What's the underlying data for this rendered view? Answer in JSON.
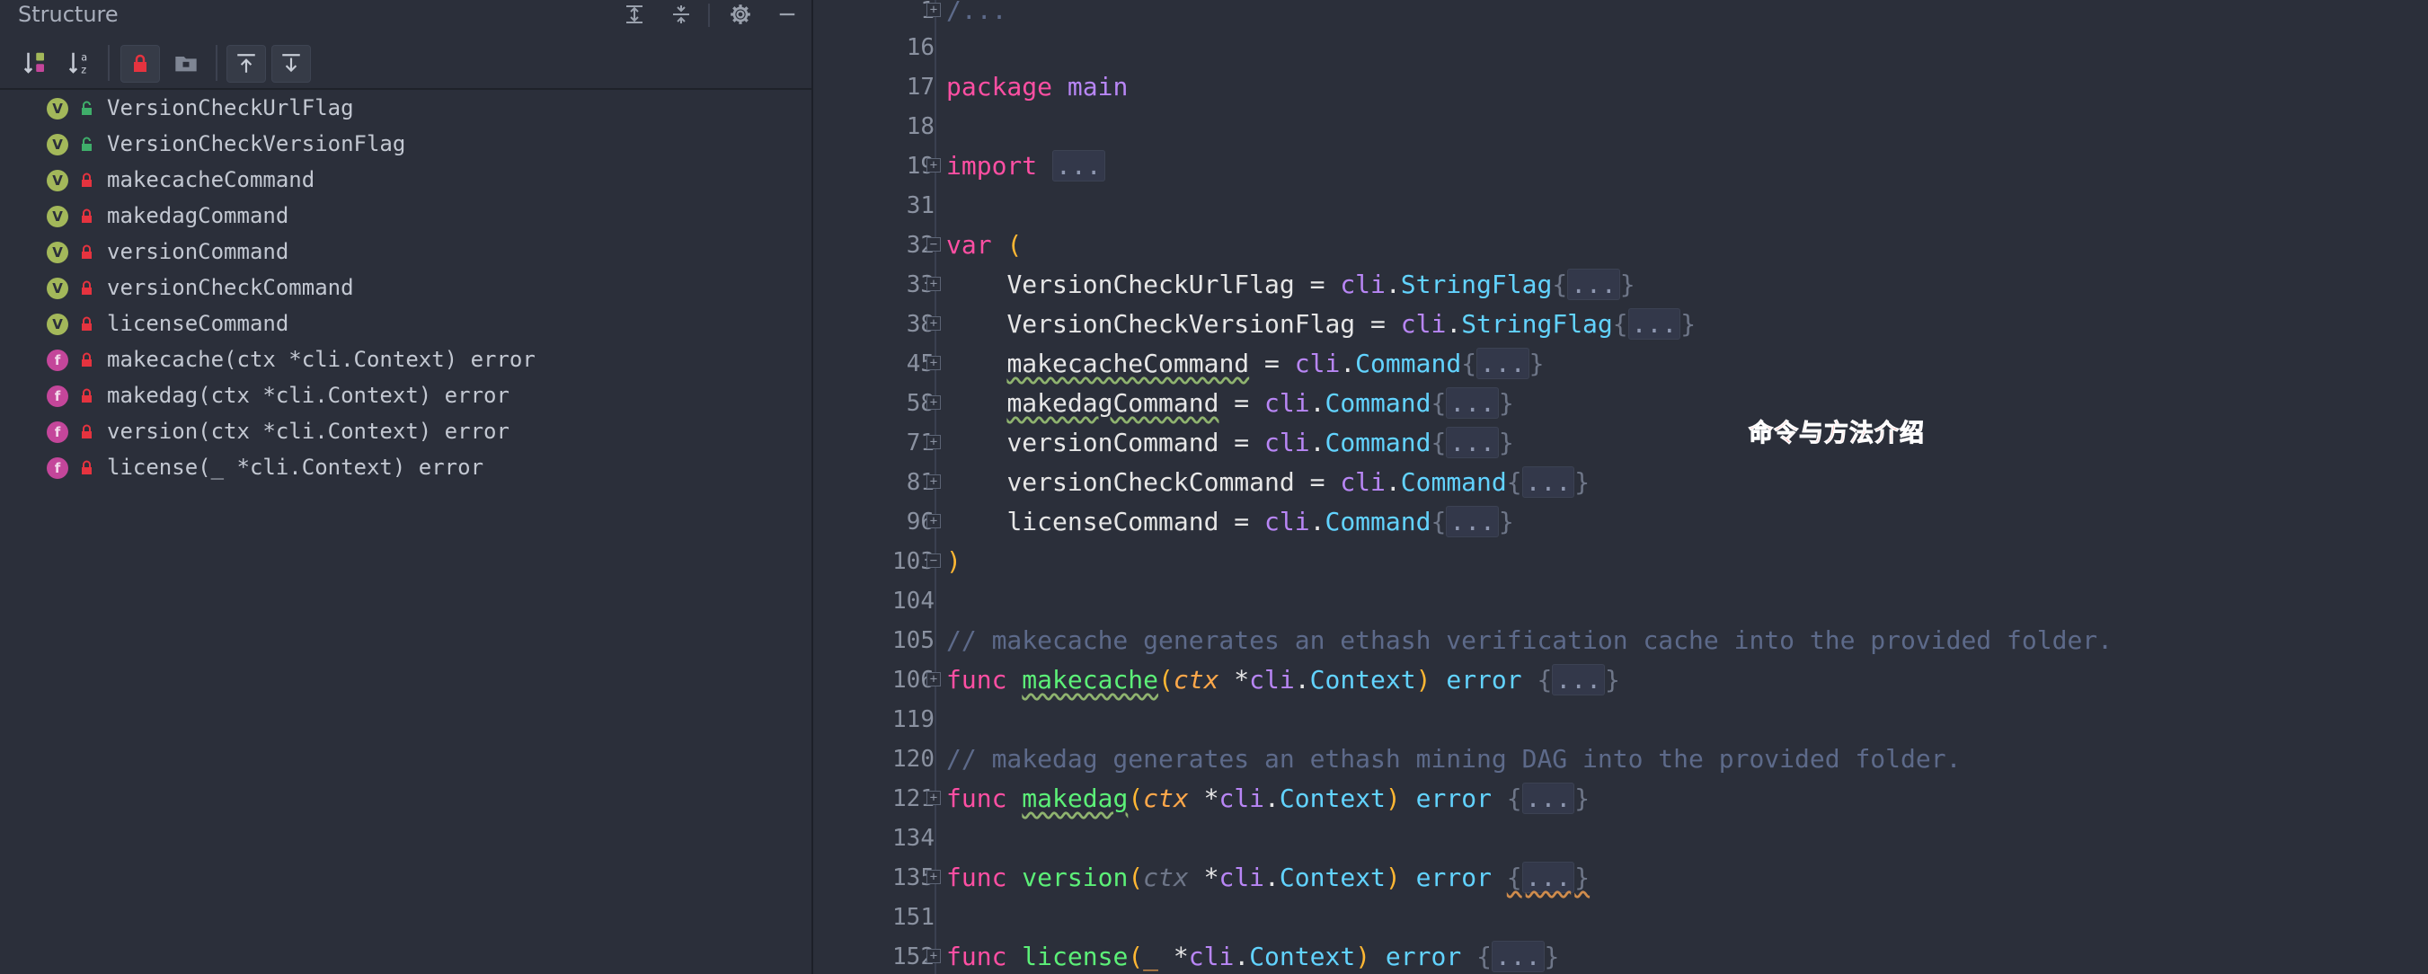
{
  "structure_panel": {
    "title": "Structure",
    "header_icons": [
      "expand-all-icon",
      "collapse-all-icon",
      "gear-icon",
      "minimize-icon"
    ],
    "toolbar_icons": [
      "sort-by-type-icon",
      "sort-alphabetically-icon",
      "show-non-public-icon",
      "show-fields-icon",
      "navigate-from-source-icon",
      "navigate-to-source-icon"
    ],
    "items": [
      {
        "kind": "V",
        "access": "public",
        "label": "VersionCheckUrlFlag"
      },
      {
        "kind": "V",
        "access": "public",
        "label": "VersionCheckVersionFlag"
      },
      {
        "kind": "V",
        "access": "private",
        "label": "makecacheCommand"
      },
      {
        "kind": "V",
        "access": "private",
        "label": "makedagCommand"
      },
      {
        "kind": "V",
        "access": "private",
        "label": "versionCommand"
      },
      {
        "kind": "V",
        "access": "private",
        "label": "versionCheckCommand"
      },
      {
        "kind": "V",
        "access": "private",
        "label": "licenseCommand"
      },
      {
        "kind": "f",
        "access": "private",
        "label": "makecache(ctx *cli.Context) error"
      },
      {
        "kind": "f",
        "access": "private",
        "label": "makedag(ctx *cli.Context) error"
      },
      {
        "kind": "f",
        "access": "private",
        "label": "version(ctx *cli.Context) error"
      },
      {
        "kind": "f",
        "access": "private",
        "label": "license(_ *cli.Context) error"
      }
    ]
  },
  "editor": {
    "line_numbers": [
      "1",
      "16",
      "17",
      "18",
      "19",
      "31",
      "32",
      "33",
      "38",
      "45",
      "58",
      "71",
      "81",
      "96",
      "103",
      "104",
      "105",
      "106",
      "119",
      "120",
      "121",
      "134",
      "135",
      "151",
      "152"
    ],
    "code": {
      "l1": "/...",
      "package_kw": "package",
      "package_name": "main",
      "import_kw": "import",
      "ellipsis": "...",
      "var_kw": "var",
      "open_paren": "(",
      "close_paren": ")",
      "vars": [
        {
          "name": "VersionCheckUrlFlag",
          "pkg": "cli",
          "type": "StringFlag"
        },
        {
          "name": "VersionCheckVersionFlag",
          "pkg": "cli",
          "type": "StringFlag"
        },
        {
          "name": "makecacheCommand",
          "pkg": "cli",
          "type": "Command"
        },
        {
          "name": "makedagCommand",
          "pkg": "cli",
          "type": "Command"
        },
        {
          "name": "versionCommand",
          "pkg": "cli",
          "type": "Command"
        },
        {
          "name": "versionCheckCommand",
          "pkg": "cli",
          "type": "Command"
        },
        {
          "name": "licenseCommand",
          "pkg": "cli",
          "type": "Command"
        }
      ],
      "comment_makecache": "// makecache generates an ethash verification cache into the provided folder.",
      "comment_makedag": "// makedag generates an ethash mining DAG into the provided folder.",
      "funcs": [
        {
          "name": "makecache",
          "param": "ctx",
          "pkg": "cli",
          "type": "Context",
          "ret": "error"
        },
        {
          "name": "makedag",
          "param": "ctx",
          "pkg": "cli",
          "type": "Context",
          "ret": "error"
        },
        {
          "name": "version",
          "param": "ctx",
          "pkg": "cli",
          "type": "Context",
          "ret": "error"
        },
        {
          "name": "license",
          "param": "_",
          "pkg": "cli",
          "type": "Context",
          "ret": "error"
        }
      ]
    }
  },
  "annotation": "命令与方法介绍"
}
